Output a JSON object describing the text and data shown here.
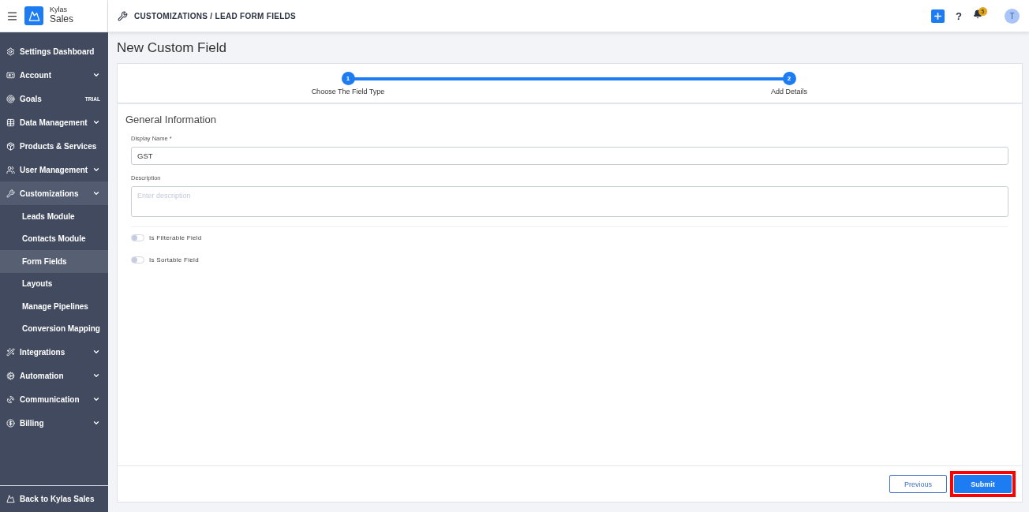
{
  "brand": {
    "top": "Kylas",
    "name": "Sales"
  },
  "breadcrumb": "CUSTOMIZATIONS / LEAD FORM FIELDS",
  "header": {
    "help": "?",
    "notifications": "5",
    "avatar": "T"
  },
  "sidebar": {
    "items": [
      {
        "label": "Settings Dashboard",
        "expandable": false,
        "selected": false
      },
      {
        "label": "Account",
        "expandable": true,
        "selected": false
      },
      {
        "label": "Goals",
        "expandable": false,
        "selected": false,
        "badge": "TRIAL"
      },
      {
        "label": "Data Management",
        "expandable": true,
        "selected": false
      },
      {
        "label": "Products & Services",
        "expandable": false,
        "selected": false
      },
      {
        "label": "User Management",
        "expandable": true,
        "selected": false
      },
      {
        "label": "Customizations",
        "expandable": true,
        "selected": true,
        "children": [
          {
            "label": "Leads Module",
            "selected": false
          },
          {
            "label": "Contacts Module",
            "selected": false
          },
          {
            "label": "Form Fields",
            "selected": true
          },
          {
            "label": "Layouts",
            "selected": false
          },
          {
            "label": "Manage Pipelines",
            "selected": false
          },
          {
            "label": "Conversion Mapping",
            "selected": false
          }
        ]
      },
      {
        "label": "Integrations",
        "expandable": true,
        "selected": false
      },
      {
        "label": "Automation",
        "expandable": true,
        "selected": false
      },
      {
        "label": "Communication",
        "expandable": true,
        "selected": false
      },
      {
        "label": "Billing",
        "expandable": true,
        "selected": false
      }
    ],
    "footer": "Back to Kylas Sales"
  },
  "page_title": "New Custom Field",
  "steps": [
    {
      "number": "1",
      "label": "Choose The Field Type",
      "done": true
    },
    {
      "number": "2",
      "label": "Add Details",
      "done": true
    }
  ],
  "section_title": "General Information",
  "fields": [
    {
      "label": "Display Name *",
      "value": "GST",
      "kind": "text"
    },
    {
      "label": "Description",
      "placeholder": "Enter description",
      "kind": "textarea"
    }
  ],
  "toggles": [
    {
      "label": "Is Filterable Field",
      "on": false
    },
    {
      "label": "Is Sortable Field",
      "on": false
    }
  ],
  "buttons": [
    {
      "label": "Previous",
      "kind": "secondary",
      "highlighted": false
    },
    {
      "label": "Submit",
      "kind": "primary",
      "highlighted": true
    }
  ]
}
